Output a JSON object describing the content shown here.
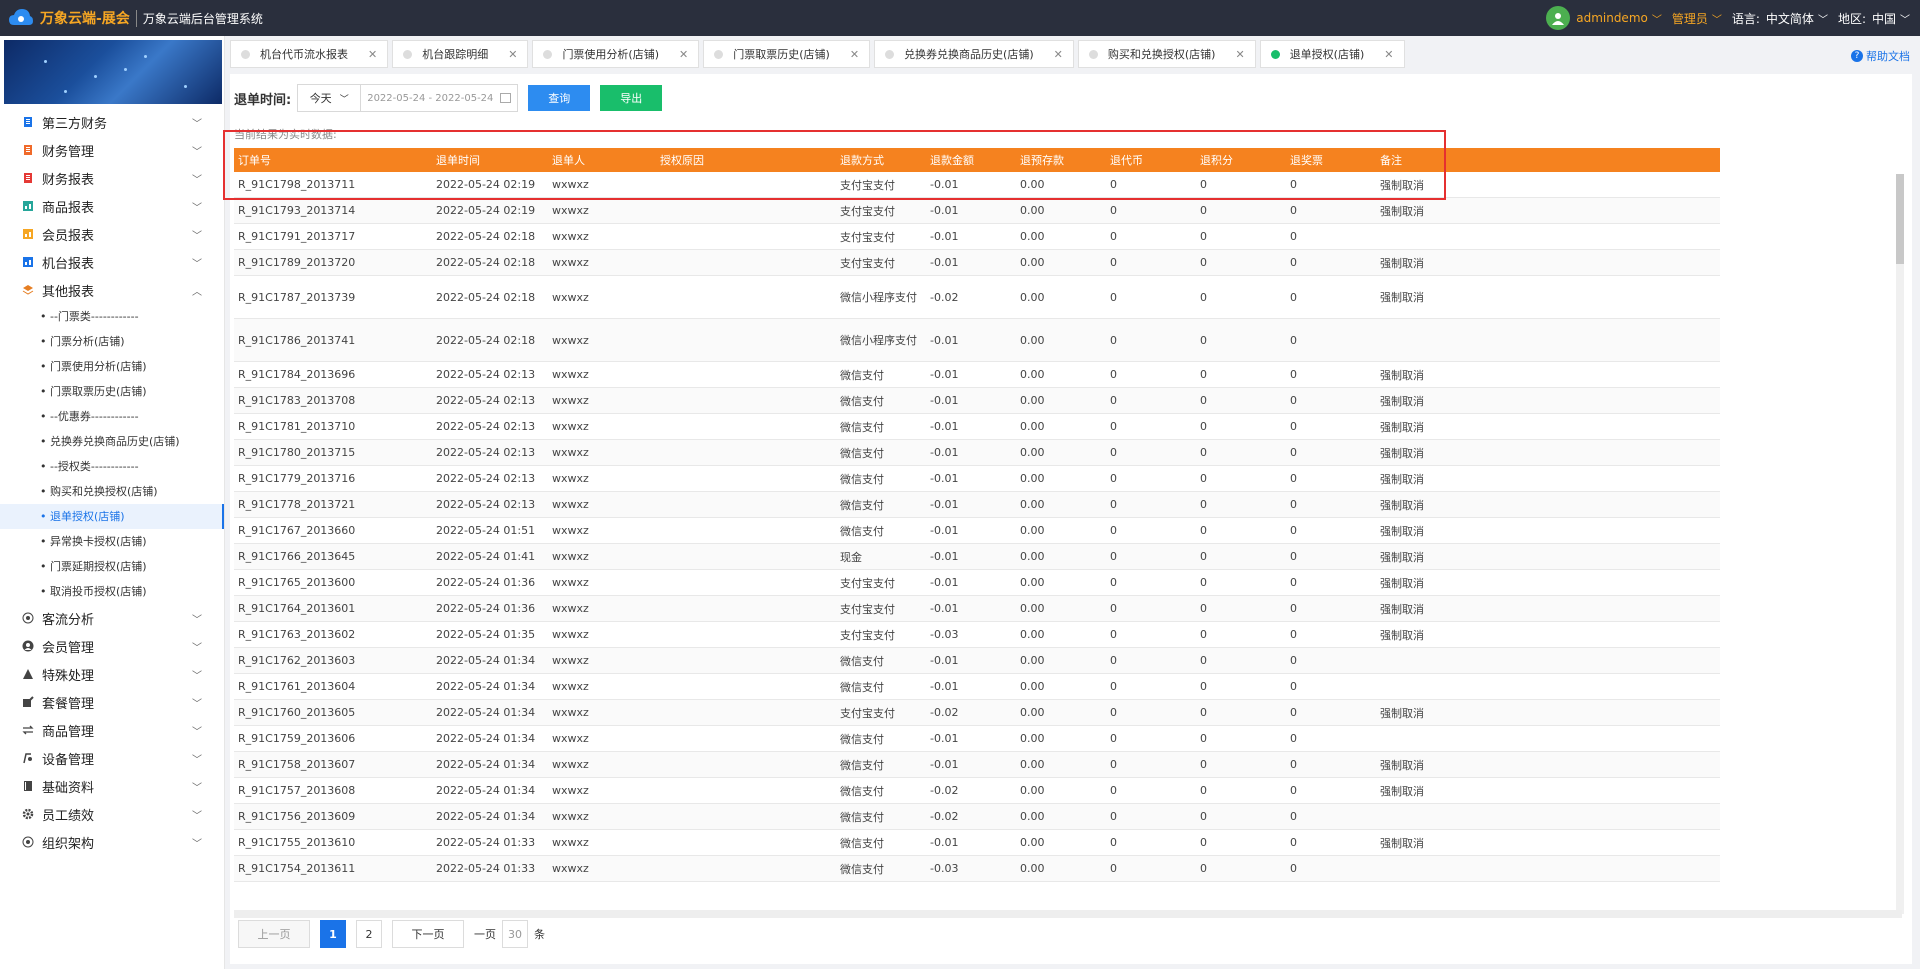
{
  "header": {
    "brand": "万象云端-展会",
    "subtitle": "万象云端后台管理系统",
    "user": "admindemo",
    "role": "管理员",
    "language_label": "语言:",
    "language_value": "中文简体",
    "region_label": "地区:",
    "region_value": "中国"
  },
  "sidebar": {
    "items": [
      {
        "label": "第三方财务",
        "icon": "doc-icon",
        "color": "#1a73e8"
      },
      {
        "label": "财务管理",
        "icon": "doc-icon",
        "color": "#f06a2a"
      },
      {
        "label": "财务报表",
        "icon": "doc-icon",
        "color": "#e53935"
      },
      {
        "label": "商品报表",
        "icon": "report-icon",
        "color": "#26a69a"
      },
      {
        "label": "会员报表",
        "icon": "report-icon",
        "color": "#f6a623"
      },
      {
        "label": "机台报表",
        "icon": "report-icon",
        "color": "#1a73e8"
      },
      {
        "label": "其他报表",
        "icon": "layers-icon",
        "color": "#e67e22"
      }
    ],
    "sub_items": [
      "• --门票类------------",
      "• 门票分析(店铺)",
      "• 门票使用分析(店铺)",
      "• 门票取票历史(店铺)",
      "• --优惠券------------",
      "• 兑换券兑换商品历史(店铺)",
      "• --授权类------------",
      "• 购买和兑换授权(店铺)",
      "• 退单授权(店铺)",
      "• 异常换卡授权(店铺)",
      "• 门票延期授权(店铺)",
      "• 取消投币授权(店铺)"
    ],
    "active_sub": 8,
    "items2": [
      {
        "label": "客流分析",
        "icon": "target-icon"
      },
      {
        "label": "会员管理",
        "icon": "user-icon"
      },
      {
        "label": "特殊处理",
        "icon": "warning-icon"
      },
      {
        "label": "套餐管理",
        "icon": "edit-icon"
      },
      {
        "label": "商品管理",
        "icon": "swap-icon"
      },
      {
        "label": "设备管理",
        "icon": "device-icon"
      },
      {
        "label": "基础资料",
        "icon": "book-icon"
      },
      {
        "label": "员工绩效",
        "icon": "gear-icon"
      },
      {
        "label": "组织架构",
        "icon": "target-icon"
      }
    ]
  },
  "tabs": [
    {
      "label": "机台代币流水报表",
      "active": false
    },
    {
      "label": "机台跟踪明细",
      "active": false
    },
    {
      "label": "门票使用分析(店铺)",
      "active": false
    },
    {
      "label": "门票取票历史(店铺)",
      "active": false
    },
    {
      "label": "兑换券兑换商品历史(店铺)",
      "active": false
    },
    {
      "label": "购买和兑换授权(店铺)",
      "active": false
    },
    {
      "label": "退单授权(店铺)",
      "active": true
    }
  ],
  "help_label": "帮助文档",
  "filter": {
    "label": "退单时间:",
    "period": "今天",
    "date_range": "2022-05-24 - 2022-05-24",
    "query_button": "查询",
    "export_button": "导出"
  },
  "note": "当前结果为实时数据:",
  "table": {
    "columns": [
      "订单号",
      "退单时间",
      "退单人",
      "授权原因",
      "退款方式",
      "退款金额",
      "退预存款",
      "退代币",
      "退积分",
      "退奖票",
      "备注"
    ],
    "rows": [
      [
        "R_91C1798_2013711",
        "2022-05-24 02:19",
        "wxwxz",
        "",
        "支付宝支付",
        "-0.01",
        "0.00",
        "0",
        "0",
        "0",
        "强制取消"
      ],
      [
        "R_91C1793_2013714",
        "2022-05-24 02:19",
        "wxwxz",
        "",
        "支付宝支付",
        "-0.01",
        "0.00",
        "0",
        "0",
        "0",
        "强制取消"
      ],
      [
        "R_91C1791_2013717",
        "2022-05-24 02:18",
        "wxwxz",
        "",
        "支付宝支付",
        "-0.01",
        "0.00",
        "0",
        "0",
        "0",
        ""
      ],
      [
        "R_91C1789_2013720",
        "2022-05-24 02:18",
        "wxwxz",
        "",
        "支付宝支付",
        "-0.01",
        "0.00",
        "0",
        "0",
        "0",
        "强制取消"
      ],
      [
        "R_91C1787_2013739",
        "2022-05-24 02:18",
        "wxwxz",
        "",
        "微信小程序支付",
        "-0.02",
        "0.00",
        "0",
        "0",
        "0",
        "强制取消"
      ],
      [
        "R_91C1786_2013741",
        "2022-05-24 02:18",
        "wxwxz",
        "",
        "微信小程序支付",
        "-0.01",
        "0.00",
        "0",
        "0",
        "0",
        ""
      ],
      [
        "R_91C1784_2013696",
        "2022-05-24 02:13",
        "wxwxz",
        "",
        "微信支付",
        "-0.01",
        "0.00",
        "0",
        "0",
        "0",
        "强制取消"
      ],
      [
        "R_91C1783_2013708",
        "2022-05-24 02:13",
        "wxwxz",
        "",
        "微信支付",
        "-0.01",
        "0.00",
        "0",
        "0",
        "0",
        "强制取消"
      ],
      [
        "R_91C1781_2013710",
        "2022-05-24 02:13",
        "wxwxz",
        "",
        "微信支付",
        "-0.01",
        "0.00",
        "0",
        "0",
        "0",
        "强制取消"
      ],
      [
        "R_91C1780_2013715",
        "2022-05-24 02:13",
        "wxwxz",
        "",
        "微信支付",
        "-0.01",
        "0.00",
        "0",
        "0",
        "0",
        "强制取消"
      ],
      [
        "R_91C1779_2013716",
        "2022-05-24 02:13",
        "wxwxz",
        "",
        "微信支付",
        "-0.01",
        "0.00",
        "0",
        "0",
        "0",
        "强制取消"
      ],
      [
        "R_91C1778_2013721",
        "2022-05-24 02:13",
        "wxwxz",
        "",
        "微信支付",
        "-0.01",
        "0.00",
        "0",
        "0",
        "0",
        "强制取消"
      ],
      [
        "R_91C1767_2013660",
        "2022-05-24 01:51",
        "wxwxz",
        "",
        "微信支付",
        "-0.01",
        "0.00",
        "0",
        "0",
        "0",
        "强制取消"
      ],
      [
        "R_91C1766_2013645",
        "2022-05-24 01:41",
        "wxwxz",
        "",
        "现金",
        "-0.01",
        "0.00",
        "0",
        "0",
        "0",
        "强制取消"
      ],
      [
        "R_91C1765_2013600",
        "2022-05-24 01:36",
        "wxwxz",
        "",
        "支付宝支付",
        "-0.01",
        "0.00",
        "0",
        "0",
        "0",
        "强制取消"
      ],
      [
        "R_91C1764_2013601",
        "2022-05-24 01:36",
        "wxwxz",
        "",
        "支付宝支付",
        "-0.01",
        "0.00",
        "0",
        "0",
        "0",
        "强制取消"
      ],
      [
        "R_91C1763_2013602",
        "2022-05-24 01:35",
        "wxwxz",
        "",
        "支付宝支付",
        "-0.03",
        "0.00",
        "0",
        "0",
        "0",
        "强制取消"
      ],
      [
        "R_91C1762_2013603",
        "2022-05-24 01:34",
        "wxwxz",
        "",
        "微信支付",
        "-0.01",
        "0.00",
        "0",
        "0",
        "0",
        ""
      ],
      [
        "R_91C1761_2013604",
        "2022-05-24 01:34",
        "wxwxz",
        "",
        "微信支付",
        "-0.01",
        "0.00",
        "0",
        "0",
        "0",
        ""
      ],
      [
        "R_91C1760_2013605",
        "2022-05-24 01:34",
        "wxwxz",
        "",
        "支付宝支付",
        "-0.02",
        "0.00",
        "0",
        "0",
        "0",
        "强制取消"
      ],
      [
        "R_91C1759_2013606",
        "2022-05-24 01:34",
        "wxwxz",
        "",
        "微信支付",
        "-0.01",
        "0.00",
        "0",
        "0",
        "0",
        ""
      ],
      [
        "R_91C1758_2013607",
        "2022-05-24 01:34",
        "wxwxz",
        "",
        "微信支付",
        "-0.01",
        "0.00",
        "0",
        "0",
        "0",
        "强制取消"
      ],
      [
        "R_91C1757_2013608",
        "2022-05-24 01:34",
        "wxwxz",
        "",
        "微信支付",
        "-0.02",
        "0.00",
        "0",
        "0",
        "0",
        "强制取消"
      ],
      [
        "R_91C1756_2013609",
        "2022-05-24 01:34",
        "wxwxz",
        "",
        "微信支付",
        "-0.02",
        "0.00",
        "0",
        "0",
        "0",
        ""
      ],
      [
        "R_91C1755_2013610",
        "2022-05-24 01:33",
        "wxwxz",
        "",
        "微信支付",
        "-0.01",
        "0.00",
        "0",
        "0",
        "0",
        "强制取消"
      ],
      [
        "R_91C1754_2013611",
        "2022-05-24 01:33",
        "wxwxz",
        "",
        "微信支付",
        "-0.03",
        "0.00",
        "0",
        "0",
        "0",
        ""
      ]
    ]
  },
  "pager": {
    "prev": "上一页",
    "pages": [
      "1",
      "2"
    ],
    "current": "1",
    "next": "下一页",
    "size_prefix": "一页",
    "size": "30",
    "size_suffix": "条"
  }
}
